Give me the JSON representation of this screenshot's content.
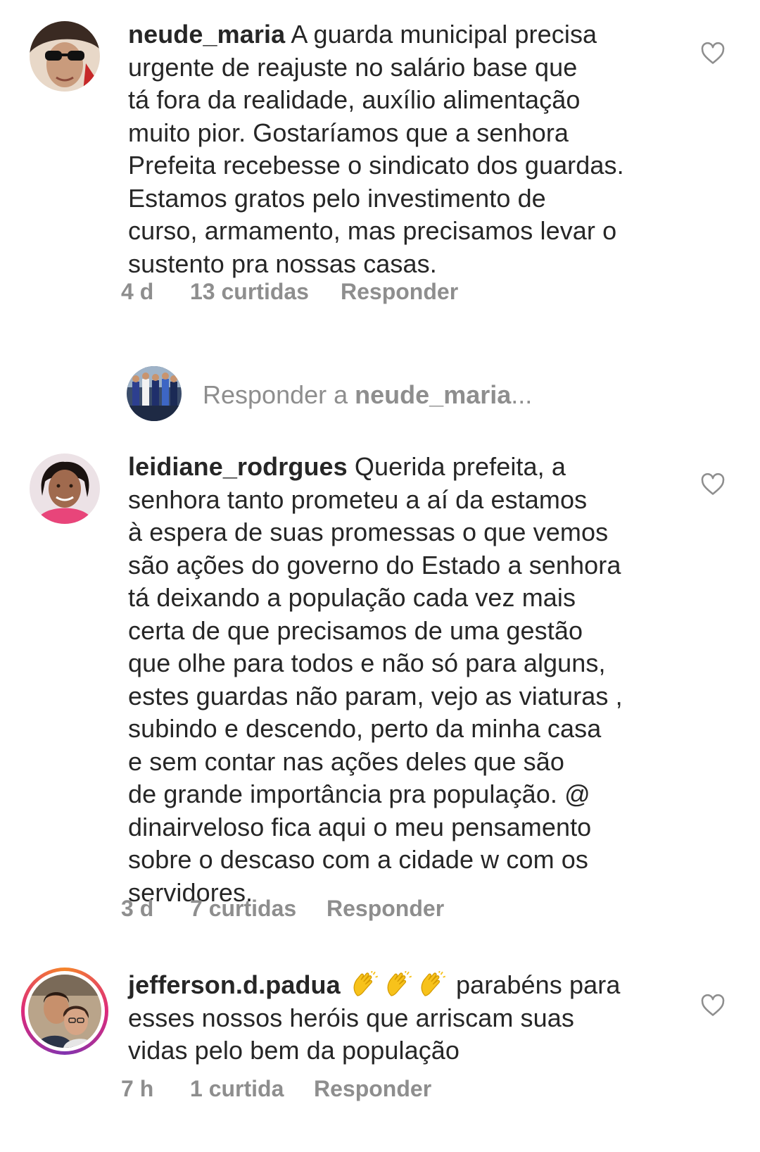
{
  "comments": [
    {
      "username": "neude_maria",
      "text": "A guarda municipal precisa urgente de reajuste no salário base que tá fora da realidade, auxílio alimentação muito pior. Gostaríamos que a senhora Prefeita recebesse o sindicato dos guardas. Estamos gratos pelo investimento de curso, armamento, mas precisamos levar o sustento pra nossas casas.",
      "lines": [
        "A guarda municipal precisa",
        "urgente de reajuste no salário base que",
        "tá fora da realidade, auxílio alimentação",
        "muito pior. Gostaríamos que a senhora",
        "Prefeita recebesse o sindicato dos guardas.",
        "Estamos gratos pelo investimento de",
        "curso, armamento, mas precisamos levar o",
        "sustento pra nossas casas."
      ],
      "time": "4 d",
      "likes": "13 curtidas",
      "reply_label": "Responder"
    },
    {
      "username": "leidiane_rodrgues",
      "lines": [
        "Querida prefeita, a",
        "senhora tanto prometeu a aí da estamos",
        "à espera de suas promessas o que vemos",
        "são  ações  do governo do Estado a senhora",
        "tá  deixando a população  cada vez mais",
        "certa de que precisamos de uma gestão",
        "que olhe para todos e não  só  para alguns,",
        "estes guardas não  param, vejo as viaturas ,",
        "subindo e descendo, perto da minha casa",
        "e sem contar nas ações  deles que são",
        "de grande importância  pra população. @",
        "dinairveloso fica aqui o meu pensamento",
        "sobre o descaso com a cidade w com os",
        "servidores."
      ],
      "time": "3 d",
      "likes": "7 curtidas",
      "reply_label": "Responder"
    },
    {
      "username": "jefferson.d.padua",
      "lines": [
        "parabéns para",
        "esses  nossos heróis que arriscam suas",
        "vidas pelo bem da população"
      ],
      "emoji": "clapping-hands",
      "time": "7 h",
      "likes": "1 curtida",
      "reply_label": "Responder"
    }
  ],
  "reply_prompt": {
    "prefix": "Responder a",
    "username": "neude_maria",
    "suffix": "..."
  },
  "colors": {
    "text": "#262626",
    "muted": "#8e8e8e",
    "emoji": "#f7c21b"
  }
}
